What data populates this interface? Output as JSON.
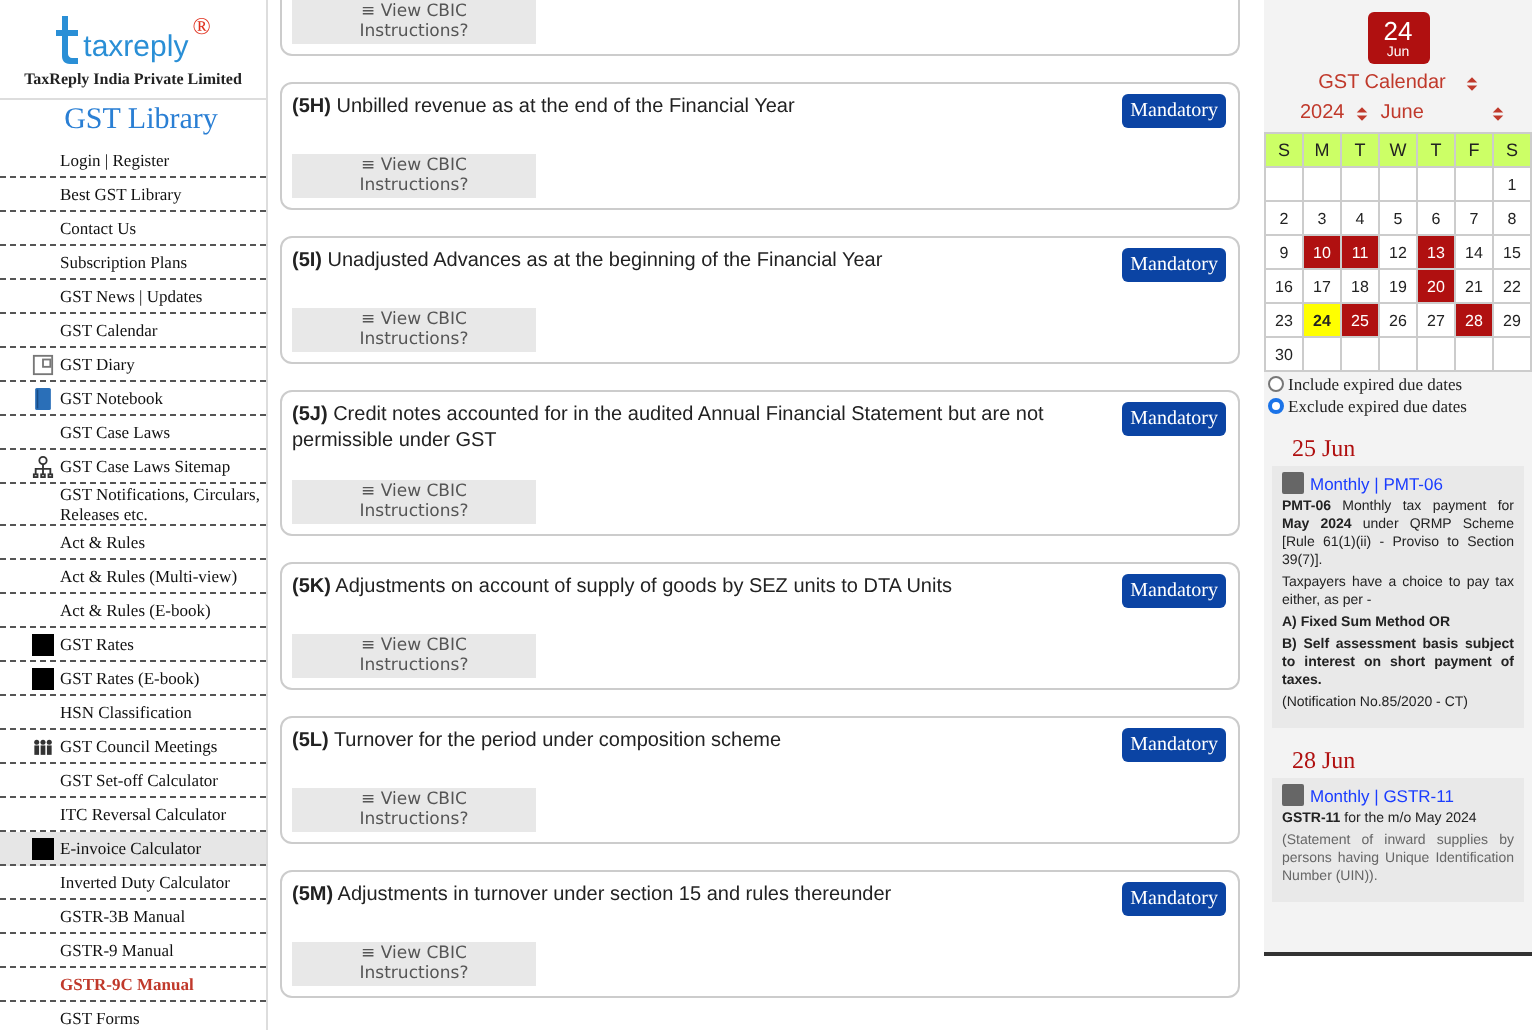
{
  "sidebar": {
    "brand": "taxreply",
    "registered": "®",
    "company": "TaxReply India Private Limited",
    "heading": "GST Library",
    "items": [
      {
        "kind": "plain",
        "label": "Login | Register",
        "selected": false,
        "hover": false
      },
      {
        "kind": "plain",
        "label": "Best GST Library",
        "selected": false,
        "hover": false
      },
      {
        "kind": "plain",
        "label": "Contact Us",
        "selected": false,
        "hover": false
      },
      {
        "kind": "plain",
        "label": "Subscription Plans",
        "selected": false,
        "hover": false
      },
      {
        "kind": "plain",
        "label": "GST News | Updates",
        "selected": false,
        "hover": false
      },
      {
        "kind": "plain",
        "label": "GST Calendar",
        "selected": false,
        "hover": false
      },
      {
        "kind": "diary",
        "label": "GST Diary",
        "selected": false,
        "hover": false
      },
      {
        "kind": "notebook",
        "label": "GST Notebook",
        "selected": false,
        "hover": false
      },
      {
        "kind": "plain",
        "label": "GST Case Laws",
        "selected": false,
        "hover": false
      },
      {
        "kind": "sitemap",
        "label": "GST Case Laws Sitemap",
        "selected": false,
        "hover": false
      },
      {
        "kind": "plain",
        "label": "GST Notifications, Circulars, Releases etc.",
        "selected": false,
        "hover": false
      },
      {
        "kind": "plain",
        "label": "Act & Rules",
        "selected": false,
        "hover": false
      },
      {
        "kind": "plain",
        "label": "Act & Rules (Multi-view)",
        "selected": false,
        "hover": false
      },
      {
        "kind": "plain",
        "label": "Act & Rules (E-book)",
        "selected": false,
        "hover": false
      },
      {
        "kind": "square",
        "label": "GST Rates",
        "selected": false,
        "hover": false
      },
      {
        "kind": "square",
        "label": "GST Rates (E-book)",
        "selected": false,
        "hover": false
      },
      {
        "kind": "plain",
        "label": "HSN Classification",
        "selected": false,
        "hover": false
      },
      {
        "kind": "people",
        "label": "GST Council Meetings",
        "selected": false,
        "hover": false
      },
      {
        "kind": "plain",
        "label": "GST Set-off Calculator",
        "selected": false,
        "hover": false
      },
      {
        "kind": "plain",
        "label": "ITC Reversal Calculator",
        "selected": false,
        "hover": false
      },
      {
        "kind": "square",
        "label": "E-invoice Calculator",
        "selected": false,
        "hover": true
      },
      {
        "kind": "plain",
        "label": "Inverted Duty Calculator",
        "selected": false,
        "hover": false
      },
      {
        "kind": "plain",
        "label": "GSTR-3B Manual",
        "selected": false,
        "hover": false
      },
      {
        "kind": "plain",
        "label": "GSTR-9 Manual",
        "selected": false,
        "hover": false
      },
      {
        "kind": "plain",
        "label": "GSTR-9C Manual",
        "selected": true,
        "hover": false
      },
      {
        "kind": "plain",
        "label": "GST Forms",
        "selected": false,
        "hover": false
      }
    ]
  },
  "cards": [
    {
      "kind": "partial",
      "button": "≡ View CBIC Instructions?"
    },
    {
      "kind": "item",
      "title": "**(5H)** Unbilled revenue as at the end of the Financial Year",
      "badge": "Mandatory",
      "button": "≡ View CBIC Instructions?"
    },
    {
      "kind": "item",
      "title": "**(5I)** Unadjusted Advances as at the beginning of the Financial Year",
      "badge": "Mandatory",
      "button": "≡ View CBIC Instructions?"
    },
    {
      "kind": "item",
      "title": "**(5J)** Credit notes accounted for in the audited Annual Financial Statement but are not permissible under GST",
      "badge": "Mandatory",
      "button": "≡ View CBIC Instructions?"
    },
    {
      "kind": "item",
      "title": "**(5K)** Adjustments on account of supply of goods by SEZ units to DTA Units",
      "badge": "Mandatory",
      "button": "≡ View CBIC Instructions?"
    },
    {
      "kind": "item",
      "title": "**(5L)** Turnover for the period under composition scheme",
      "badge": "Mandatory",
      "button": "≡ View CBIC Instructions?"
    },
    {
      "kind": "item",
      "title": "**(5M)** Adjustments in turnover under section 15 and rules thereunder",
      "badge": "Mandatory",
      "button": "≡ View CBIC Instructions?"
    }
  ],
  "calendar": {
    "date_badge": {
      "day": "24",
      "month": "Jun"
    },
    "calendar_select": "GST Calendar",
    "year_select": "2024",
    "month_select": "June",
    "weekdays": [
      "S",
      "M",
      "T",
      "W",
      "T",
      "F",
      "S"
    ],
    "weeks": [
      [
        {
          "kind": "blank"
        },
        {
          "kind": "blank"
        },
        {
          "kind": "blank"
        },
        {
          "kind": "blank"
        },
        {
          "kind": "blank"
        },
        {
          "kind": "blank"
        },
        {
          "kind": "day",
          "day": "1",
          "due": false,
          "today": false
        }
      ],
      [
        {
          "kind": "day",
          "day": "2",
          "due": false,
          "today": false
        },
        {
          "kind": "day",
          "day": "3",
          "due": false,
          "today": false
        },
        {
          "kind": "day",
          "day": "4",
          "due": false,
          "today": false
        },
        {
          "kind": "day",
          "day": "5",
          "due": false,
          "today": false
        },
        {
          "kind": "day",
          "day": "6",
          "due": false,
          "today": false
        },
        {
          "kind": "day",
          "day": "7",
          "due": false,
          "today": false
        },
        {
          "kind": "day",
          "day": "8",
          "due": false,
          "today": false
        }
      ],
      [
        {
          "kind": "day",
          "day": "9",
          "due": false,
          "today": false
        },
        {
          "kind": "day",
          "day": "10",
          "due": true,
          "today": false
        },
        {
          "kind": "day",
          "day": "11",
          "due": true,
          "today": false
        },
        {
          "kind": "day",
          "day": "12",
          "due": false,
          "today": false
        },
        {
          "kind": "day",
          "day": "13",
          "due": true,
          "today": false
        },
        {
          "kind": "day",
          "day": "14",
          "due": false,
          "today": false
        },
        {
          "kind": "day",
          "day": "15",
          "due": false,
          "today": false
        }
      ],
      [
        {
          "kind": "day",
          "day": "16",
          "due": false,
          "today": false
        },
        {
          "kind": "day",
          "day": "17",
          "due": false,
          "today": false
        },
        {
          "kind": "day",
          "day": "18",
          "due": false,
          "today": false
        },
        {
          "kind": "day",
          "day": "19",
          "due": false,
          "today": false
        },
        {
          "kind": "day",
          "day": "20",
          "due": true,
          "today": false
        },
        {
          "kind": "day",
          "day": "21",
          "due": false,
          "today": false
        },
        {
          "kind": "day",
          "day": "22",
          "due": false,
          "today": false
        }
      ],
      [
        {
          "kind": "day",
          "day": "23",
          "due": false,
          "today": false
        },
        {
          "kind": "day",
          "day": "24",
          "due": false,
          "today": true
        },
        {
          "kind": "day",
          "day": "25",
          "due": true,
          "today": false
        },
        {
          "kind": "day",
          "day": "26",
          "due": false,
          "today": false
        },
        {
          "kind": "day",
          "day": "27",
          "due": false,
          "today": false
        },
        {
          "kind": "day",
          "day": "28",
          "due": true,
          "today": false
        },
        {
          "kind": "day",
          "day": "29",
          "due": false,
          "today": false
        }
      ],
      [
        {
          "kind": "day",
          "day": "30",
          "due": false,
          "today": false
        },
        {
          "kind": "blank"
        },
        {
          "kind": "blank"
        },
        {
          "kind": "blank"
        },
        {
          "kind": "blank"
        },
        {
          "kind": "blank"
        },
        {
          "kind": "blank"
        }
      ]
    ],
    "filters": [
      {
        "label": "Include expired due dates",
        "selected": false
      },
      {
        "label": "Exclude expired due dates",
        "selected": true
      }
    ],
    "events": [
      {
        "date": "25 Jun",
        "checked": true,
        "link": "Monthly | PMT-06",
        "paragraphs": [
          {
            "text": "**PMT-06** Monthly tax payment for **May 2024** under QRMP Scheme [Rule 61(1)(ii) - Proviso to Section 39(7)].",
            "bold": false
          },
          {
            "text": "Taxpayers have a choice to pay tax either, as per -",
            "bold": false
          },
          {
            "text": "A) Fixed Sum Method **OR**",
            "bold": true
          },
          {
            "text": "B) Self assessment basis subject to interest on short payment of taxes.",
            "bold": true
          },
          {
            "text": "(Notification No.85/2020 - CT)",
            "bold": false
          }
        ]
      },
      {
        "date": "28 Jun",
        "checked": true,
        "link": "Monthly | GSTR-11",
        "paragraphs": [
          {
            "text": "**GSTR-11** for the m/o May 2024",
            "bold": false
          },
          {
            "text": "(Statement of inward supplies by persons having Unique Identification Number (UIN)).",
            "bold": false
          }
        ]
      }
    ]
  }
}
